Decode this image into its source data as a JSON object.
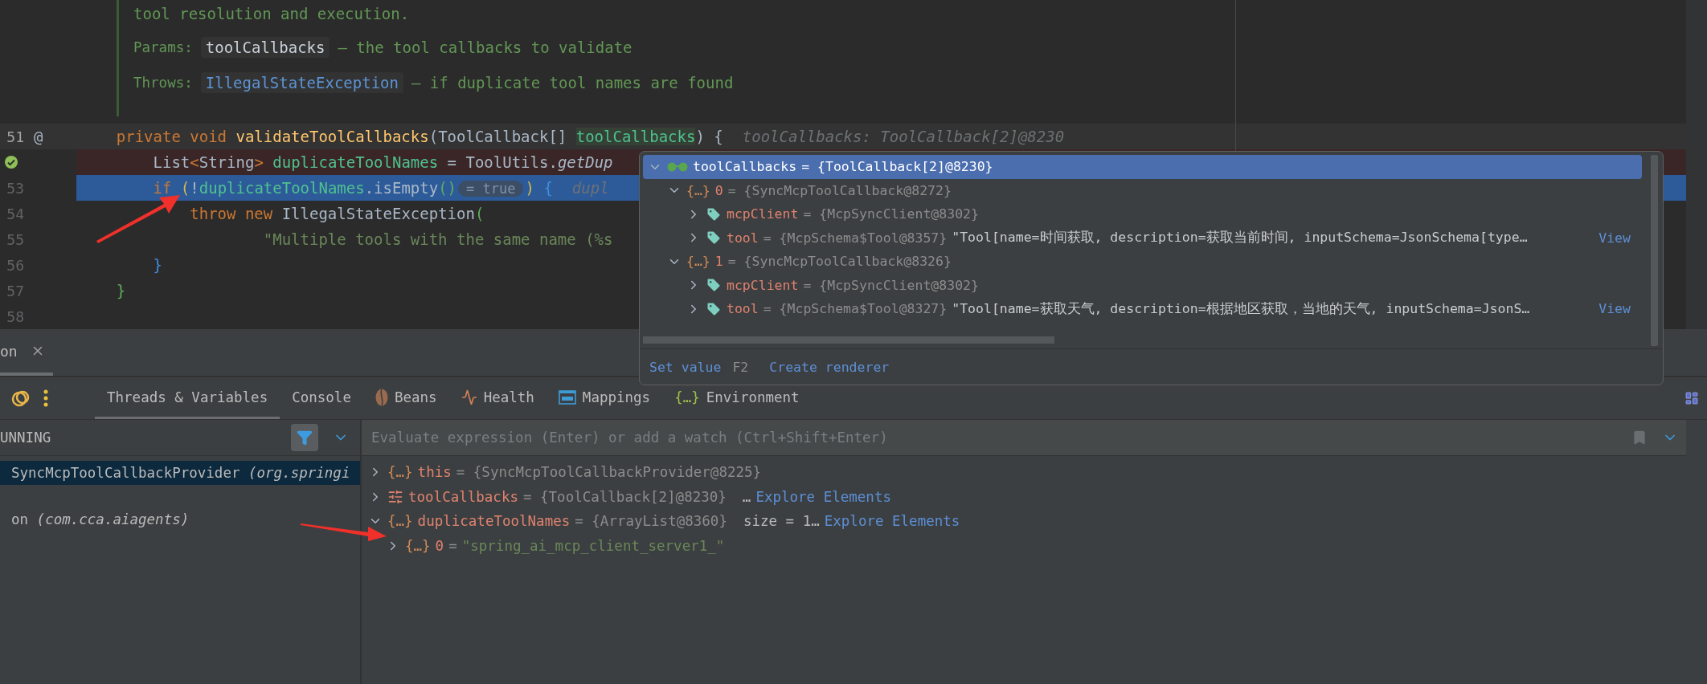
{
  "doc_comment": {
    "text": "tool resolution and execution.",
    "params_label": "Params:",
    "param_name": "toolCallbacks",
    "param_desc": "– the tool callbacks to validate",
    "throws_label": "Throws:",
    "throws_type": "IllegalStateException",
    "throws_desc": "– if duplicate tool names are found"
  },
  "code_lines": [
    {
      "number": "51",
      "gutter_mark": "@",
      "current_line": true,
      "breakpoint": false,
      "execution_point": false,
      "tokens": [
        {
          "kind": "keyword",
          "text": "    private void "
        },
        {
          "kind": "method",
          "text": "validateToolCallbacks"
        },
        {
          "kind": "plain",
          "text": "(ToolCallback[] "
        },
        {
          "kind": "param",
          "text": "toolCallbacks"
        },
        {
          "kind": "plain",
          "text": ") {"
        }
      ],
      "inlay": "toolCallbacks: ToolCallback[2]@8230"
    },
    {
      "current_line": false,
      "breakpoint": true,
      "execution_point": false,
      "tokens": [
        {
          "kind": "plain",
          "text": "        List"
        },
        {
          "kind": "keyword",
          "text": "<"
        },
        {
          "kind": "plain",
          "text": "String"
        },
        {
          "kind": "keyword",
          "text": ">"
        },
        {
          "kind": "field",
          "text": " duplicateToolNames"
        },
        {
          "kind": "plain",
          "text": " = ToolUtils."
        },
        {
          "kind": "static",
          "text": "getDup"
        }
      ]
    },
    {
      "number": "53",
      "current_line": false,
      "breakpoint": false,
      "execution_point": true,
      "tokens": [
        {
          "kind": "keyword",
          "text": "        if "
        },
        {
          "kind": "paren",
          "text": "("
        },
        {
          "kind": "plain",
          "text": "!"
        },
        {
          "kind": "field",
          "text": "duplicateToolNames"
        },
        {
          "kind": "plain",
          "text": ".isEmpty"
        },
        {
          "kind": "paren2",
          "text": "()"
        },
        {
          "kind": "hint",
          "text": "= true"
        },
        {
          "kind": "paren",
          "text": ")"
        },
        {
          "kind": "brace",
          "text": " {"
        }
      ],
      "inlay": "dupl"
    },
    {
      "number": "54",
      "current_line": false,
      "breakpoint": false,
      "execution_point": false,
      "tokens": [
        {
          "kind": "keyword",
          "text": "            throw new "
        },
        {
          "kind": "plain",
          "text": "IllegalStateException"
        },
        {
          "kind": "paren2",
          "text": "("
        }
      ]
    },
    {
      "number": "55",
      "current_line": false,
      "breakpoint": false,
      "execution_point": false,
      "tokens": [
        {
          "kind": "string",
          "text": "                    \"Multiple tools with the same name (%s"
        }
      ]
    },
    {
      "number": "56",
      "current_line": false,
      "breakpoint": false,
      "execution_point": false,
      "tokens": [
        {
          "kind": "brace",
          "text": "        }"
        }
      ]
    },
    {
      "number": "57",
      "current_line": false,
      "breakpoint": false,
      "execution_point": false,
      "tokens": [
        {
          "kind": "paren2",
          "text": "    }"
        }
      ]
    },
    {
      "number": "58",
      "current_line": false,
      "breakpoint": false,
      "execution_point": false
    }
  ],
  "popup": {
    "tree": [
      {
        "kind": "watch",
        "name": "toolCallbacks",
        "value": "= {ToolCallback[2]@8230}",
        "selected": true,
        "expanded": true,
        "children": [
          {
            "kind": "object",
            "badge": "{…}",
            "name": "0",
            "value": "= {SyncMcpToolCallback@8272}",
            "selected": false,
            "expanded": true,
            "children": [
              {
                "kind": "field",
                "name": "mcpClient",
                "value": "= {McpSyncClient@8302}",
                "selected": false,
                "expanded": false
              },
              {
                "kind": "field",
                "name": "tool",
                "value": "= {McpSchema$Tool@8357}",
                "string": "\"Tool[name=时间获取, description=获取当前时间, inputSchema=JsonSchema[type…",
                "link": "View",
                "selected": false,
                "expanded": false
              }
            ]
          },
          {
            "kind": "object",
            "badge": "{…}",
            "name": "1",
            "value": "= {SyncMcpToolCallback@8326}",
            "selected": false,
            "expanded": true,
            "children": [
              {
                "kind": "field",
                "name": "mcpClient",
                "value": "= {McpSyncClient@8302}",
                "selected": false,
                "expanded": false
              },
              {
                "kind": "field",
                "name": "tool",
                "value": "= {McpSchema$Tool@8327}",
                "string": "\"Tool[name=获取天气, description=根据地区获取，当地的天气, inputSchema=JsonS…",
                "link": "View",
                "selected": false,
                "expanded": false
              }
            ]
          }
        ]
      }
    ],
    "set_value": "Set value",
    "shortcut": "F2",
    "create_renderer": "Create renderer"
  },
  "session_tab": {
    "label": "on"
  },
  "debug_tabs": [
    {
      "label": "Threads & Variables",
      "selected": true
    },
    {
      "label": "Console",
      "selected": false
    },
    {
      "label": "Beans",
      "selected": false
    },
    {
      "label": "Health",
      "selected": false
    },
    {
      "label": "Mappings",
      "selected": false
    },
    {
      "label": "Environment",
      "badge": "{…}",
      "selected": false
    }
  ],
  "threads": {
    "status": "UNNING",
    "frames": [
      {
        "text": "SyncMcpToolCallbackProvider *(org.springi*",
        "selected": true
      },
      {
        "text": "on *(com.cca.aiagents)*",
        "selected": false
      }
    ]
  },
  "evaluate": {
    "placeholder": "Evaluate expression (Enter) or add a watch (Ctrl+Shift+Enter)"
  },
  "variables": [
    {
      "kind": "object",
      "badge": "{…}",
      "name": "this",
      "value": "= {SyncMcpToolCallbackProvider@8225}",
      "expanded": false
    },
    {
      "kind": "array",
      "name": "toolCallbacks",
      "value": "= {ToolCallback[2]@8230}",
      "extra": "…",
      "link": "Explore Elements",
      "expanded": false
    },
    {
      "kind": "object",
      "badge": "{…}",
      "name": "duplicateToolNames",
      "value": "= {ArrayList@8360}",
      "extra": "size = 1…",
      "link": "Explore Elements",
      "expanded": true,
      "children": [
        {
          "kind": "object",
          "badge": "{…}",
          "name": "0",
          "value": "=",
          "string": "\"spring_ai_mcp_client_server1_\"",
          "expanded": false
        }
      ]
    }
  ]
}
